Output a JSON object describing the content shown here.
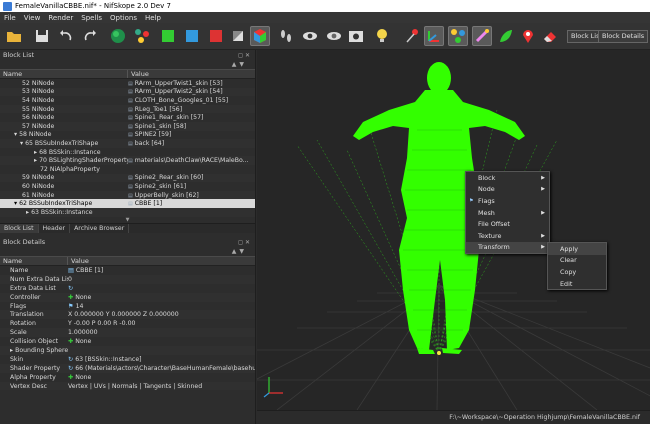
{
  "window": {
    "title": "FemaleVanillaCBBE.nif* - NifSkope 2.0 Dev 7"
  },
  "menu": [
    "File",
    "View",
    "Render",
    "Spells",
    "Options",
    "Help"
  ],
  "toolbar": {
    "block_list_btn": "Block List",
    "block_details_btn": "Block Details"
  },
  "block_list": {
    "title": "Block List",
    "col_name": "Name",
    "col_value": "Value",
    "rows": [
      {
        "name": "52 NiNode",
        "value": "RArm_UpperTwist1_skin [53]",
        "indent": 22
      },
      {
        "name": "53 NiNode",
        "value": "RArm_UpperTwist2_skin [54]",
        "indent": 22
      },
      {
        "name": "54 NiNode",
        "value": "CLOTH_Bone_Googles_01 [55]",
        "indent": 22
      },
      {
        "name": "55 NiNode",
        "value": "RLeg_Toe1 [56]",
        "indent": 22
      },
      {
        "name": "56 NiNode",
        "value": "Spine1_Rear_skin [57]",
        "indent": 22
      },
      {
        "name": "57 NiNode",
        "value": "Spine1_skin [58]",
        "indent": 22
      },
      {
        "name": "▾ 58 NiNode",
        "value": "SPINE2 [59]",
        "indent": 14
      },
      {
        "name": "▾ 65 BSSubIndexTriShape",
        "value": "back [64]",
        "indent": 20
      },
      {
        "name": "▸ 68 BSSkin::Instance",
        "value": "",
        "indent": 34
      },
      {
        "name": "▸ 70 BSLightingShaderProperty",
        "value": "materials\\DeathClaw\\RACE\\MaleBo...",
        "indent": 34
      },
      {
        "name": "72 NiAlphaProperty",
        "value": "",
        "indent": 40
      },
      {
        "name": "59 NiNode",
        "value": "Spine2_Rear_skin [60]",
        "indent": 22
      },
      {
        "name": "60 NiNode",
        "value": "Spine2_skin [61]",
        "indent": 22
      },
      {
        "name": "61 NiNode",
        "value": "UpperBelly_skin [62]",
        "indent": 22
      },
      {
        "name": "▾ 62 BSSubIndexTriShape",
        "value": "CBBE [1]",
        "indent": 14,
        "selected": true
      },
      {
        "name": "▸ 63 BSSkin::Instance",
        "value": "",
        "indent": 26
      }
    ],
    "tabs": [
      "Block List",
      "Header",
      "Archive Browser"
    ]
  },
  "block_details": {
    "title": "Block Details",
    "col_name": "Name",
    "col_value": "Value",
    "rows": [
      {
        "name": "Name",
        "value": "CBBE [1]",
        "icon": "txt"
      },
      {
        "name": "Num Extra Data List",
        "value": "0",
        "icon": ""
      },
      {
        "name": "Extra Data List",
        "value": "",
        "icon": "link"
      },
      {
        "name": "Controller",
        "value": "None",
        "icon": "plus"
      },
      {
        "name": "Flags",
        "value": "14",
        "icon": "flag"
      },
      {
        "name": "Translation",
        "value": "X 0.000000 Y 0.000000 Z 0.000000",
        "icon": ""
      },
      {
        "name": "Rotation",
        "value": "Y -0.00 P 0.00 R -0.00",
        "icon": ""
      },
      {
        "name": "Scale",
        "value": "1.000000",
        "icon": ""
      },
      {
        "name": "Collision Object",
        "value": "None",
        "icon": "plus"
      },
      {
        "name": "▸ Bounding Sphere",
        "value": "",
        "icon": ""
      },
      {
        "name": "Skin",
        "value": "63 [BSSkin::Instance]",
        "icon": "link"
      },
      {
        "name": "Shader Property",
        "value": "66 (Materials\\actors\\Character\\BaseHumanFemale\\basehu...",
        "icon": "link"
      },
      {
        "name": "Alpha Property",
        "value": "None",
        "icon": "plus"
      },
      {
        "name": "Vertex Desc",
        "value": "Vertex | UVs | Normals | Tangents | Skinned",
        "icon": ""
      }
    ]
  },
  "context_menu": {
    "items": [
      "Block",
      "Node",
      "Flags",
      "Mesh",
      "File Offset",
      "Texture",
      "Transform"
    ],
    "submenu": [
      "Apply",
      "Clear",
      "Copy",
      "Edit"
    ]
  },
  "status": {
    "path": "F:\\~Workspace\\~Operation Highjump\\FemaleVanillaCBBE.nif"
  },
  "colors": {
    "mesh": "#33ff00",
    "background": "#262626",
    "grid": "#3a3a3a"
  }
}
